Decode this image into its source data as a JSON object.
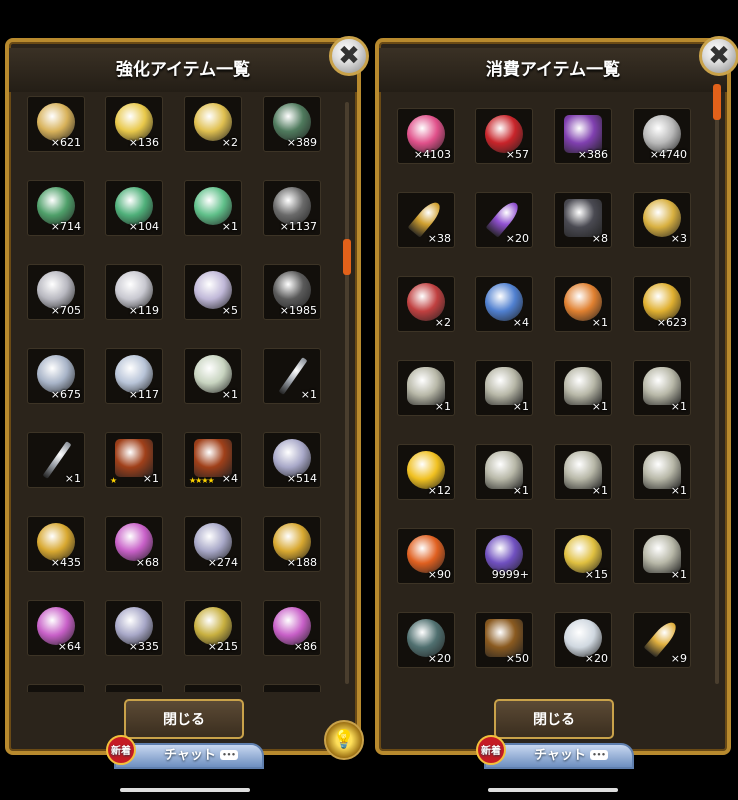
{
  "left_panel": {
    "title": "強化アイテム一覧",
    "close_glyph": "✖",
    "button_label": "閉じる",
    "chat_label": "チャット",
    "chat_badge": "新着",
    "chat_dots": "•••",
    "items": [
      {
        "count": "×621",
        "icon": "gold-skull-gem-icon",
        "color": "#d8b25a"
      },
      {
        "count": "×136",
        "icon": "gold-flower-gem-icon",
        "color": "#e8c84a"
      },
      {
        "count": "×2",
        "icon": "gold-rainbow-gem-icon",
        "color": "#e0c050"
      },
      {
        "count": "×389",
        "icon": "green-orb-gem-icon",
        "color": "#4f7a5d"
      },
      {
        "count": "×714",
        "icon": "green-skull-gem-icon",
        "color": "#4fa06a"
      },
      {
        "count": "×104",
        "icon": "green-flower-gem-icon",
        "color": "#4fb07a"
      },
      {
        "count": "×1",
        "icon": "green-rainbow-gem-icon",
        "color": "#60c08a"
      },
      {
        "count": "×1137",
        "icon": "gray-orb-gem-icon",
        "color": "#6a6a6a"
      },
      {
        "count": "×705",
        "icon": "silver-skull-gem-icon",
        "color": "#b8b8c0"
      },
      {
        "count": "×119",
        "icon": "silver-flower-gem-icon",
        "color": "#c8c8d0"
      },
      {
        "count": "×5",
        "icon": "silver-rainbow-gem-icon",
        "color": "#c0b8d8"
      },
      {
        "count": "×1985",
        "icon": "dark-orb-gem-icon",
        "color": "#5a5a5a"
      },
      {
        "count": "×675",
        "icon": "white-skull-gem-icon",
        "color": "#a8b4c8"
      },
      {
        "count": "×117",
        "icon": "white-flower-gem-icon",
        "color": "#b8c4d8"
      },
      {
        "count": "×1",
        "icon": "white-rainbow-gem-icon",
        "color": "#c8d4c0"
      },
      {
        "count": "×1",
        "icon": "dagger-icon",
        "color": "#9aa0a8",
        "shape": "blade"
      },
      {
        "count": "×1",
        "icon": "dagger-icon",
        "color": "#9aa0a8",
        "shape": "blade"
      },
      {
        "count": "×1",
        "icon": "brick-icon",
        "color": "#a0401a",
        "shape": "sq",
        "stars": "★"
      },
      {
        "count": "×4",
        "icon": "brick-icon",
        "color": "#a0401a",
        "shape": "sq",
        "stars": "★★★★"
      },
      {
        "count": "×514",
        "icon": "spirit-silver-icon",
        "color": "#a8a8c8"
      },
      {
        "count": "×435",
        "icon": "spirit-gold-icon",
        "color": "#d8a830"
      },
      {
        "count": "×68",
        "icon": "spirit-rainbow-icon",
        "color": "#c860c8"
      },
      {
        "count": "×274",
        "icon": "spirit-silver-icon",
        "color": "#a8a8c8"
      },
      {
        "count": "×188",
        "icon": "spirit-gold-icon",
        "color": "#d8a830"
      },
      {
        "count": "×64",
        "icon": "spirit-rainbow-icon",
        "color": "#c860c8"
      },
      {
        "count": "×335",
        "icon": "spirit-silver-icon",
        "color": "#a8a8c8"
      },
      {
        "count": "×215",
        "icon": "spirit-gold-icon",
        "color": "#c8b040"
      },
      {
        "count": "×86",
        "icon": "spirit-rainbow-icon",
        "color": "#c860c8"
      }
    ]
  },
  "right_panel": {
    "title": "消費アイテム一覧",
    "close_glyph": "✖",
    "button_label": "閉じる",
    "chat_label": "チャット",
    "chat_badge": "新着",
    "chat_dots": "•••",
    "items": [
      {
        "count": "×4103",
        "icon": "heart-potion-icon",
        "color": "#e0508a"
      },
      {
        "count": "×57",
        "icon": "red-heart-gem-icon",
        "color": "#c8242a"
      },
      {
        "count": "×386",
        "icon": "ticket-icon",
        "color": "#8040b0",
        "shape": "sq"
      },
      {
        "count": "×4740",
        "icon": "silver-coin-icon",
        "color": "#b8b8b8"
      },
      {
        "count": "×38",
        "icon": "gold-key-icon",
        "color": "#d0a030",
        "shape": "key"
      },
      {
        "count": "×20",
        "icon": "purple-key-icon",
        "color": "#9050d0",
        "shape": "key"
      },
      {
        "count": "×8",
        "icon": "stone-tablet-icon",
        "color": "#4a4a52",
        "shape": "sq"
      },
      {
        "count": "×3",
        "icon": "gold-cross-icon",
        "color": "#d8b040"
      },
      {
        "count": "×2",
        "icon": "red-crystal-icon",
        "color": "#c04040"
      },
      {
        "count": "×4",
        "icon": "blue-wing-icon",
        "color": "#5080d0"
      },
      {
        "count": "×1",
        "icon": "food-plate-icon",
        "color": "#e08030"
      },
      {
        "count": "×623",
        "icon": "gold-nugget-icon",
        "color": "#e0b030"
      },
      {
        "count": "×1",
        "icon": "gravestone-icon",
        "color": "#b8b8a8",
        "shape": "stone"
      },
      {
        "count": "×1",
        "icon": "gravestone-icon",
        "color": "#b8b8a8",
        "shape": "stone"
      },
      {
        "count": "×1",
        "icon": "gravestone-icon",
        "color": "#b8b8a8",
        "shape": "stone"
      },
      {
        "count": "×1",
        "icon": "gravestone-icon",
        "color": "#b8b8a8",
        "shape": "stone"
      },
      {
        "count": "×12",
        "icon": "golden-apple-icon",
        "color": "#f0c020"
      },
      {
        "count": "×1",
        "icon": "gravestone-icon",
        "color": "#b8b8a8",
        "shape": "stone"
      },
      {
        "count": "×1",
        "icon": "gravestone-icon",
        "color": "#b8b8a8",
        "shape": "stone"
      },
      {
        "count": "×1",
        "icon": "gravestone-icon",
        "color": "#b8b8a8",
        "shape": "stone"
      },
      {
        "count": "×90",
        "icon": "pumpkin-icon",
        "color": "#e06020"
      },
      {
        "count": "9999+",
        "icon": "rainbow-crystal-icon",
        "color": "#7050c0"
      },
      {
        "count": "×15",
        "icon": "halo-icon",
        "color": "#e0c040"
      },
      {
        "count": "×1",
        "icon": "gravestone-icon",
        "color": "#b8b8a8",
        "shape": "stone"
      },
      {
        "count": "×20",
        "icon": "crossed-swords-icon",
        "color": "#507070"
      },
      {
        "count": "×50",
        "icon": "arena-ticket-icon",
        "color": "#8a5a20",
        "shape": "sq"
      },
      {
        "count": "×20",
        "icon": "white-crystal-icon",
        "color": "#d0d8e0"
      },
      {
        "count": "×9",
        "icon": "gold-key-icon",
        "color": "#e0b040",
        "shape": "key"
      }
    ]
  }
}
